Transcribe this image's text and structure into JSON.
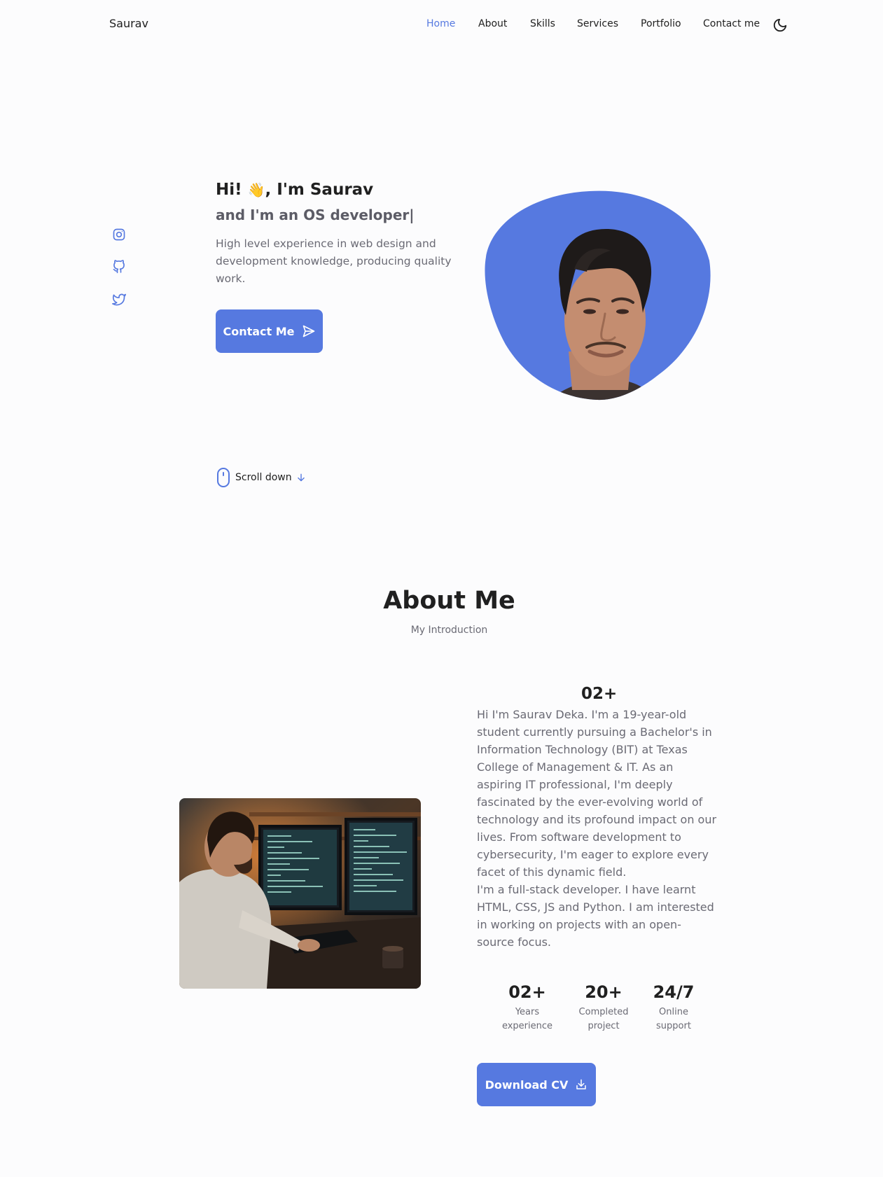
{
  "header": {
    "logo": "Saurav",
    "nav": [
      "Home",
      "About",
      "Skills",
      "Services",
      "Portfolio",
      "Contact me"
    ],
    "active": "Home",
    "theme_icon": "moon-icon"
  },
  "social": [
    "instagram-icon",
    "github-icon",
    "twitter-icon"
  ],
  "hero": {
    "greeting_start": "Hi!",
    "greeting_emoji": "👋",
    "greeting_end": ", I'm Saurav",
    "subtitle": "and I'm an OS developer|",
    "description": "High level experience in web design and development knowledge, producing quality work.",
    "contact_button": "Contact Me",
    "scroll_label": "Scroll down"
  },
  "about": {
    "title": "About Me",
    "subtitle": "My Introduction",
    "highlight": "02+",
    "paragraph1": "Hi I'm Saurav Deka. I'm a 19-year-old student currently pursuing a Bachelor's in Information Technology (BIT) at Texas College of Management & IT. As an aspiring IT professional, I'm deeply fascinated by the ever-evolving world of technology and its profound impact on our lives. From software development to cybersecurity, I'm eager to explore every facet of this dynamic field.",
    "paragraph2": "I'm a full-stack developer. I have learnt HTML, CSS, JS and Python. I am interested in working on projects with an open-source focus.",
    "stats": [
      {
        "value": "02+",
        "label1": "Years",
        "label2": "experience"
      },
      {
        "value": "20+",
        "label1": "Completed",
        "label2": "project"
      },
      {
        "value": "24/7",
        "label1": "Online",
        "label2": "support"
      }
    ],
    "download_button": "Download CV"
  },
  "colors": {
    "accent": "#5679e0",
    "text": "#202020",
    "muted": "#6a6a74",
    "background": "#fcfcfd"
  }
}
